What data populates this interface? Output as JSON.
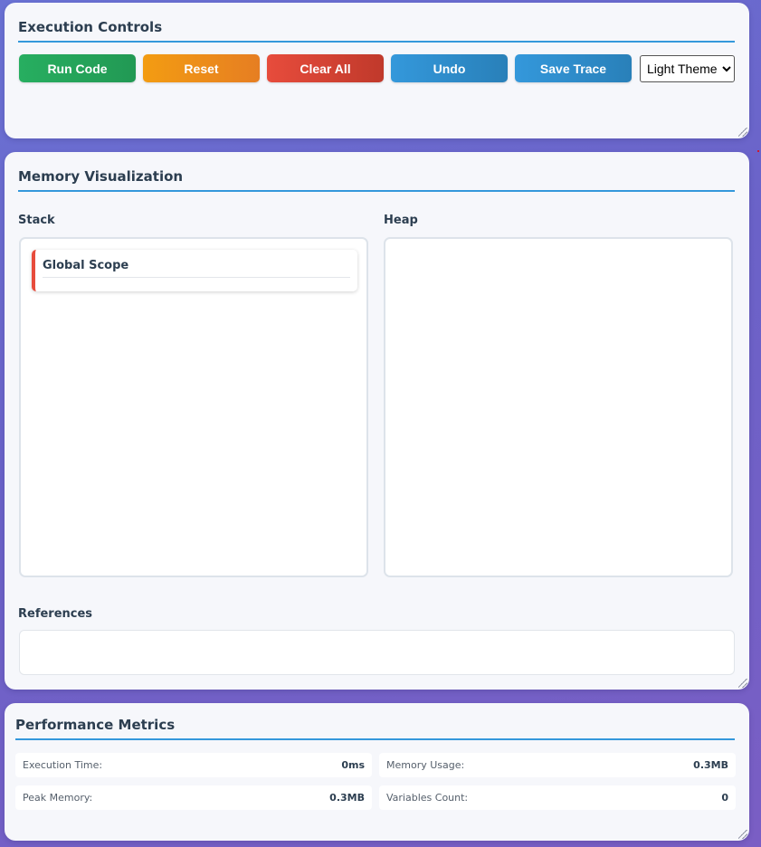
{
  "controls": {
    "title": "Execution Controls",
    "buttons": {
      "run": "Run Code",
      "reset": "Reset",
      "clear": "Clear All",
      "undo": "Undo",
      "save": "Save Trace"
    },
    "theme_selected": "Light Theme"
  },
  "memory": {
    "title": "Memory Visualization",
    "stack_label": "Stack",
    "heap_label": "Heap",
    "frames": [
      {
        "name": "Global Scope"
      }
    ],
    "references_label": "References"
  },
  "performance": {
    "title": "Performance Metrics",
    "metrics": [
      {
        "label": "Execution Time:",
        "value": "0ms"
      },
      {
        "label": "Memory Usage:",
        "value": "0.3MB"
      },
      {
        "label": "Peak Memory:",
        "value": "0.3MB"
      },
      {
        "label": "Variables Count:",
        "value": "0"
      }
    ]
  },
  "colors": {
    "accent": "#3498db",
    "run": "#27ae60",
    "reset": "#f39c12",
    "clear": "#e74c3c",
    "frame_marker": "#e74c3c"
  }
}
